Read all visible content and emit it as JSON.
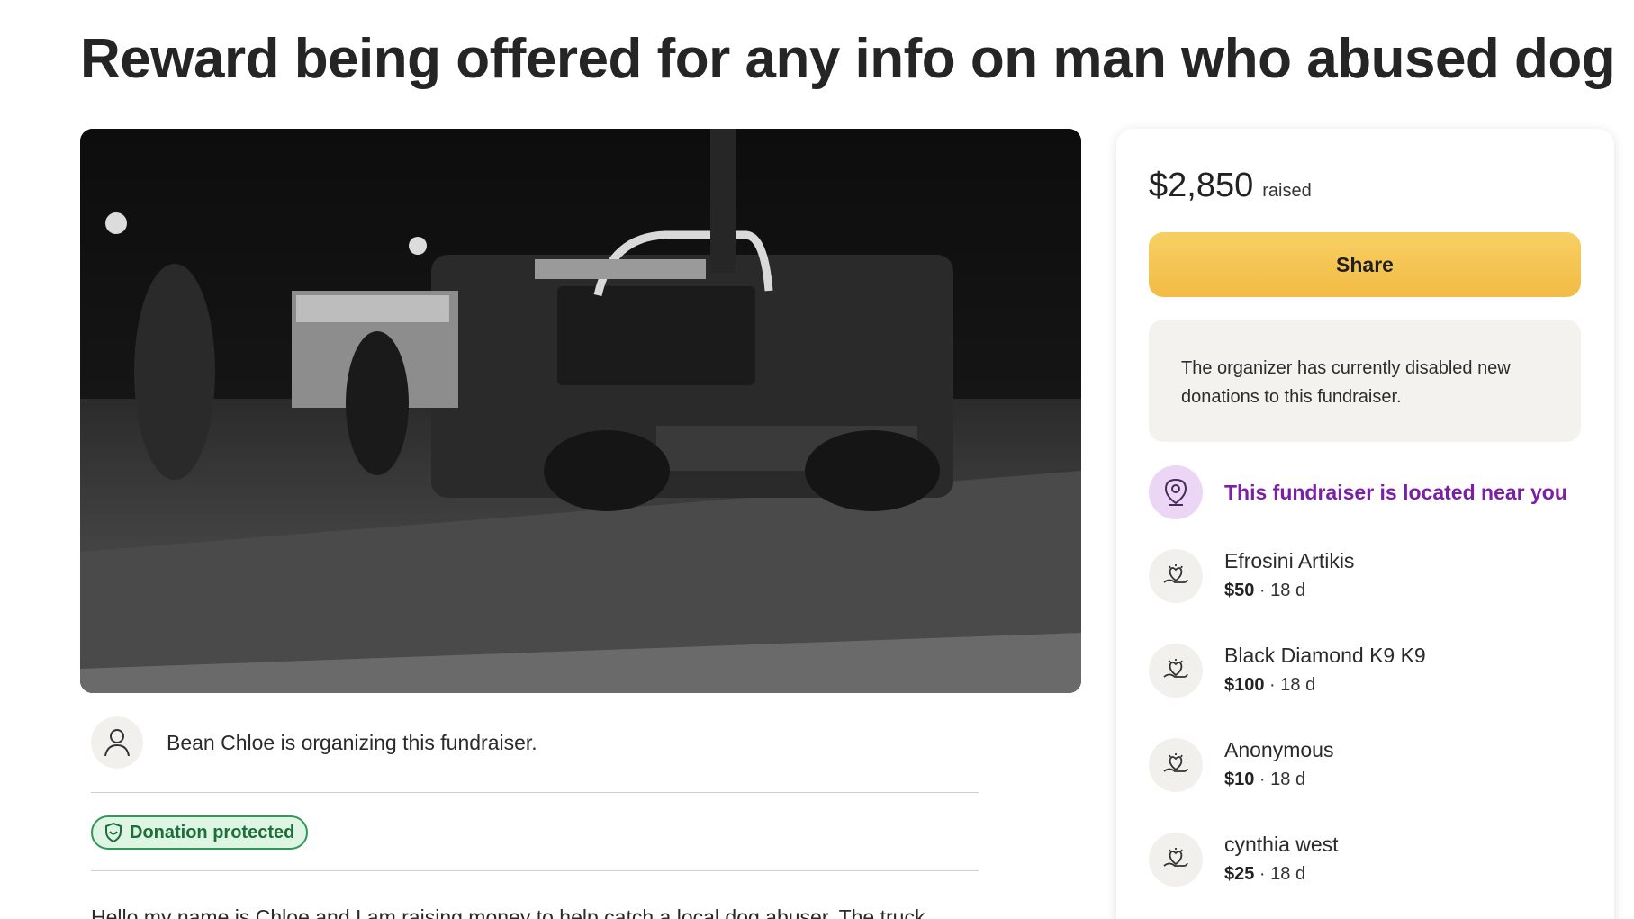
{
  "title": "Reward being offered for any info on man who abused dog",
  "organizer": {
    "text": "Bean Chloe is organizing this fundraiser."
  },
  "badge": {
    "label": "Donation protected"
  },
  "story": {
    "preview": "Hello my name is Chloe and I am raising money to help catch a local dog abuser. The truck"
  },
  "sidebar": {
    "raised_amount": "$2,850",
    "raised_label": "raised",
    "share_label": "Share",
    "notice": "The organizer has currently disabled new donations to this fundraiser.",
    "location_text": "This fundraiser is located near you",
    "donations": [
      {
        "name": "Efrosini Artikis",
        "amount": "$50",
        "time": "18 d"
      },
      {
        "name": "Black Diamond K9 K9",
        "amount": "$100",
        "time": "18 d"
      },
      {
        "name": "Anonymous",
        "amount": "$10",
        "time": "18 d"
      },
      {
        "name": "cynthia west",
        "amount": "$25",
        "time": "18 d"
      }
    ]
  },
  "colors": {
    "share_button": "#f2bb45",
    "location_accent": "#7b1fa8",
    "badge_green": "#2f9a55"
  },
  "icons": {
    "organizer": "person-icon",
    "badge": "shield-icon",
    "location": "location-pin-icon",
    "donation": "heart-hand-icon"
  }
}
